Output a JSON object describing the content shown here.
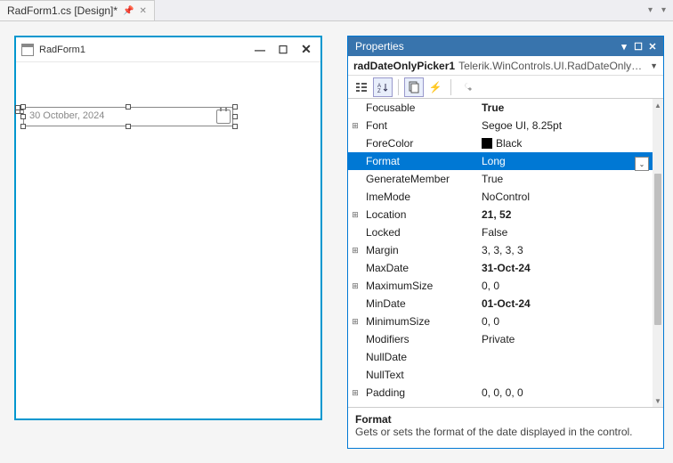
{
  "tab": {
    "title": "RadForm1.cs [Design]*"
  },
  "designer": {
    "form_title": "RadForm1",
    "date_value": "30 October, 2024"
  },
  "properties": {
    "panel_title": "Properties",
    "object_name": "radDateOnlyPicker1",
    "object_type": "Telerik.WinControls.UI.RadDateOnlyPicker",
    "rows": [
      {
        "expand": "",
        "name": "Focusable",
        "value": "True",
        "bold": true
      },
      {
        "expand": "+",
        "name": "Font",
        "value": "Segoe UI, 8.25pt"
      },
      {
        "expand": "",
        "name": "ForeColor",
        "value": "Black",
        "swatch": "#000000"
      },
      {
        "expand": "",
        "name": "Format",
        "value": "Long",
        "selected": true,
        "dropdown": true
      },
      {
        "expand": "",
        "name": "GenerateMember",
        "value": "True"
      },
      {
        "expand": "",
        "name": "ImeMode",
        "value": "NoControl"
      },
      {
        "expand": "+",
        "name": "Location",
        "value": "21, 52",
        "bold": true
      },
      {
        "expand": "",
        "name": "Locked",
        "value": "False"
      },
      {
        "expand": "+",
        "name": "Margin",
        "value": "3, 3, 3, 3"
      },
      {
        "expand": "",
        "name": "MaxDate",
        "value": "31-Oct-24",
        "bold": true
      },
      {
        "expand": "+",
        "name": "MaximumSize",
        "value": "0, 0"
      },
      {
        "expand": "",
        "name": "MinDate",
        "value": "01-Oct-24",
        "bold": true
      },
      {
        "expand": "+",
        "name": "MinimumSize",
        "value": "0, 0"
      },
      {
        "expand": "",
        "name": "Modifiers",
        "value": "Private"
      },
      {
        "expand": "",
        "name": "NullDate",
        "value": ""
      },
      {
        "expand": "",
        "name": "NullText",
        "value": ""
      },
      {
        "expand": "+",
        "name": "Padding",
        "value": "0, 0, 0, 0"
      }
    ],
    "description": {
      "name": "Format",
      "text": "Gets or sets the format of the date displayed in the control."
    }
  }
}
